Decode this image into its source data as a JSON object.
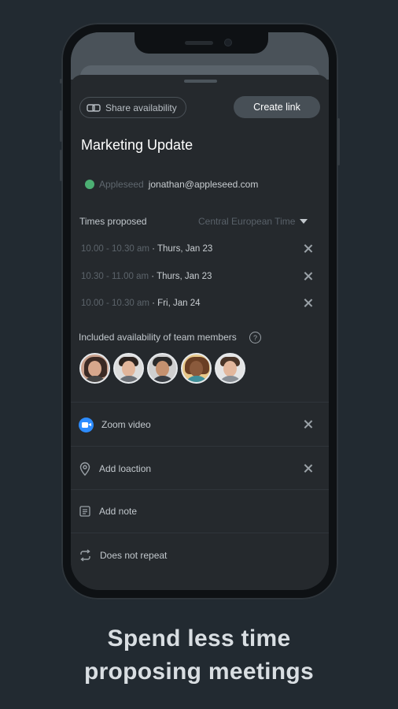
{
  "header": {
    "share_label": "Share availability",
    "create_label": "Create link"
  },
  "event": {
    "title": "Marketing Update"
  },
  "owner": {
    "name": "Appleseed",
    "email": "jonathan@appleseed.com",
    "status_color": "#4caf73"
  },
  "times": {
    "label": "Times proposed",
    "timezone": "Central European Time",
    "items": [
      {
        "range": "10.00 - 10.30 am",
        "date": "· Thurs, Jan 23"
      },
      {
        "range": "10.30 - 11.00 am",
        "date": "· Thurs, Jan 23"
      },
      {
        "range": "10.00 - 10.30 am",
        "date": "· Fri, Jan 24"
      }
    ]
  },
  "team": {
    "label": "Included availability of team members",
    "members": [
      {
        "icon": "avatar-woman-dark-hair"
      },
      {
        "icon": "avatar-man-beard"
      },
      {
        "icon": "avatar-man-cap"
      },
      {
        "icon": "avatar-woman-curly-hair"
      },
      {
        "icon": "avatar-man-smiling"
      }
    ]
  },
  "options": {
    "video": "Zoom video",
    "location": "Add loaction",
    "note": "Add note",
    "repeat": "Does not repeat"
  },
  "headline": {
    "line1": "Spend less time",
    "line2": "proposing meetings"
  },
  "colors": {
    "background": "#222a31",
    "sheet": "#25292d",
    "zoom_blue": "#2d8cff"
  }
}
